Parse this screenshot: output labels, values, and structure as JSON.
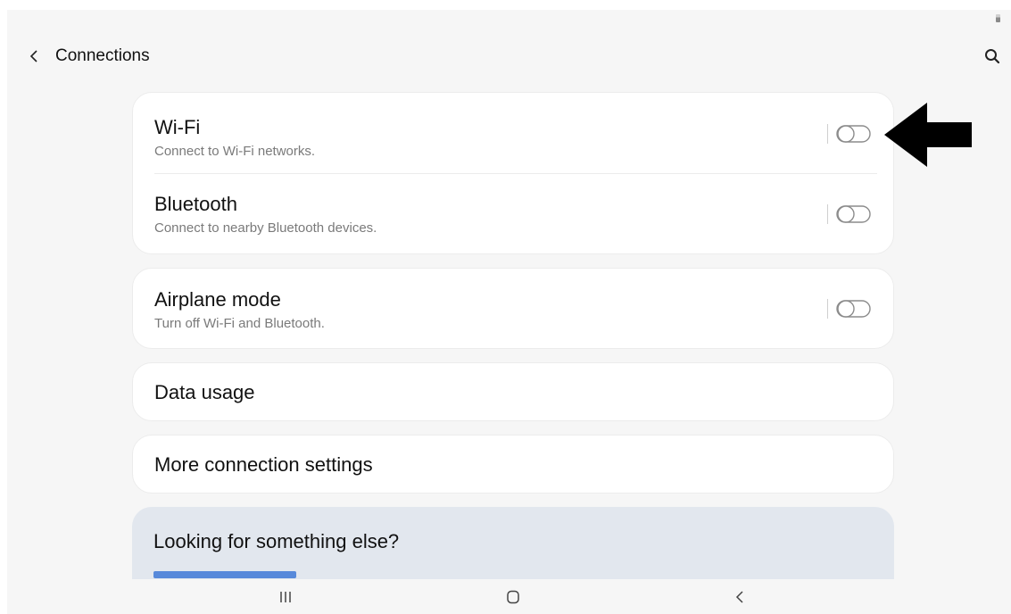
{
  "header": {
    "title": "Connections",
    "back_icon": "chevron-left-icon",
    "search_icon": "search-icon"
  },
  "connections_group": {
    "wifi": {
      "title": "Wi-Fi",
      "subtitle": "Connect to Wi-Fi networks.",
      "enabled": false
    },
    "bluetooth": {
      "title": "Bluetooth",
      "subtitle": "Connect to nearby Bluetooth devices.",
      "enabled": false
    }
  },
  "airplane": {
    "title": "Airplane mode",
    "subtitle": "Turn off Wi-Fi and Bluetooth.",
    "enabled": false
  },
  "data_usage": {
    "title": "Data usage"
  },
  "more_settings": {
    "title": "More connection settings"
  },
  "suggestions": {
    "title": "Looking for something else?"
  },
  "annotation": {
    "arrow_icon": "arrow-left-icon",
    "arrow_color": "#000000"
  },
  "navbar": {
    "recents_icon": "recents-icon",
    "home_icon": "home-icon",
    "back_icon": "back-icon"
  },
  "colors": {
    "background": "#f6f6f6",
    "card": "#ffffff",
    "suggestion_card": "#e2e7ee",
    "link": "#3e78d6"
  }
}
